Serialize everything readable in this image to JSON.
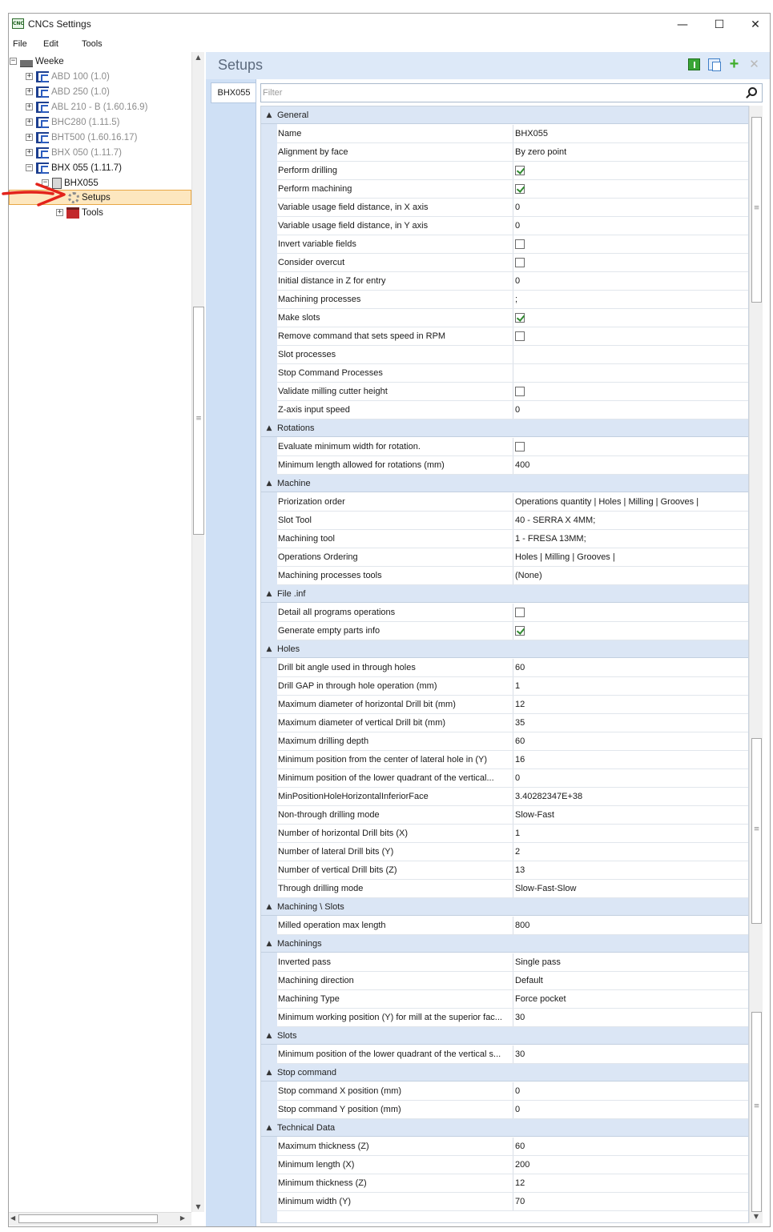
{
  "window": {
    "title": "CNCs Settings",
    "icon_label": "CNC"
  },
  "menu": [
    "File",
    "Edit",
    "Tools"
  ],
  "tree": {
    "root": "Weeke",
    "machines": [
      {
        "label": "ABD 100 (1.0)",
        "muted": true
      },
      {
        "label": "ABD 250 (1.0)",
        "muted": true
      },
      {
        "label": "ABL 210 - B (1.60.16.9)",
        "muted": true
      },
      {
        "label": "BHC280 (1.11.5)",
        "muted": true
      },
      {
        "label": "BHT500 (1.60.16.17)",
        "muted": true
      },
      {
        "label": "BHX 050 (1.11.7)",
        "muted": true
      },
      {
        "label": "BHX 055 (1.11.7)",
        "muted": false
      }
    ],
    "child": "BHX055",
    "setups": "Setups",
    "tools": "Tools"
  },
  "main": {
    "title": "Setups",
    "tab": "BHX055",
    "filter_placeholder": "Filter"
  },
  "categories": [
    {
      "name": "General",
      "rows": [
        {
          "name": "Name",
          "value": "BHX055"
        },
        {
          "name": "Alignment by face",
          "value": "By zero point"
        },
        {
          "name": "Perform drilling",
          "check": true
        },
        {
          "name": "Perform machining",
          "check": true
        },
        {
          "name": "Variable usage field distance, in X axis",
          "value": "0"
        },
        {
          "name": "Variable usage field distance, in Y axis",
          "value": "0"
        },
        {
          "name": "Invert variable fields",
          "check": false
        },
        {
          "name": "Consider overcut",
          "check": false
        },
        {
          "name": "Initial distance in Z for entry",
          "value": "0"
        },
        {
          "name": "Machining processes",
          "value": ";"
        },
        {
          "name": "Make slots",
          "check": true
        },
        {
          "name": "Remove command that sets speed in RPM",
          "check": false
        },
        {
          "name": "Slot processes",
          "value": ""
        },
        {
          "name": "Stop Command Processes",
          "value": ""
        },
        {
          "name": "Validate milling cutter height",
          "check": false
        },
        {
          "name": "Z-axis input speed",
          "value": "0"
        }
      ]
    },
    {
      "name": "Rotations",
      "rows": [
        {
          "name": "Evaluate minimum width for rotation.",
          "check": false
        },
        {
          "name": "Minimum length allowed for rotations (mm)",
          "value": "400"
        }
      ]
    },
    {
      "name": "Machine",
      "rows": [
        {
          "name": "Priorization order",
          "value": "Operations quantity | Holes | Milling | Grooves |"
        },
        {
          "name": "Slot Tool",
          "value": "40 - SERRA X 4MM;"
        },
        {
          "name": "Machining tool",
          "value": "1 - FRESA 13MM;"
        },
        {
          "name": "Operations Ordering",
          "value": "Holes | Milling | Grooves |"
        },
        {
          "name": "Machining processes tools",
          "value": "(None)"
        }
      ]
    },
    {
      "name": "File .inf",
      "rows": [
        {
          "name": "Detail all programs operations",
          "check": false
        },
        {
          "name": "Generate empty parts info",
          "check": true
        }
      ]
    },
    {
      "name": "Holes",
      "rows": [
        {
          "name": "Drill bit angle used in through holes",
          "value": "60"
        },
        {
          "name": "Drill GAP in through hole operation (mm)",
          "value": "1"
        },
        {
          "name": "Maximum diameter of horizontal Drill bit (mm)",
          "value": "12"
        },
        {
          "name": "Maximum diameter of vertical Drill bit (mm)",
          "value": "35"
        },
        {
          "name": "Maximum drilling depth",
          "value": "60"
        },
        {
          "name": "Minimum position from the center of lateral hole in (Y)",
          "value": "16"
        },
        {
          "name": "Minimum position of the lower quadrant of the vertical...",
          "value": "0"
        },
        {
          "name": "MinPositionHoleHorizontalInferiorFace",
          "value": "3.40282347E+38"
        },
        {
          "name": "Non-through drilling mode",
          "value": "Slow-Fast"
        },
        {
          "name": "Number of horizontal Drill bits (X)",
          "value": "1"
        },
        {
          "name": "Number of lateral Drill bits (Y)",
          "value": "2"
        },
        {
          "name": "Number of vertical Drill bits (Z)",
          "value": "13"
        },
        {
          "name": "Through drilling mode",
          "value": "Slow-Fast-Slow"
        }
      ]
    },
    {
      "name": "Machining \\ Slots",
      "rows": [
        {
          "name": "Milled operation max length",
          "value": "800"
        }
      ]
    },
    {
      "name": "Machinings",
      "rows": [
        {
          "name": "Inverted pass",
          "value": "Single pass"
        },
        {
          "name": "Machining direction",
          "value": "Default"
        },
        {
          "name": "Machining Type",
          "value": "Force pocket"
        },
        {
          "name": "Minimum working position (Y) for mill at the superior fac...",
          "value": "30"
        }
      ]
    },
    {
      "name": "Slots",
      "rows": [
        {
          "name": "Minimum position of the lower quadrant of the vertical s...",
          "value": "30"
        }
      ]
    },
    {
      "name": "Stop command",
      "rows": [
        {
          "name": "Stop command X position (mm)",
          "value": "0"
        },
        {
          "name": "Stop command Y position (mm)",
          "value": "0"
        }
      ]
    },
    {
      "name": "Technical Data",
      "rows": [
        {
          "name": "Maximum thickness (Z)",
          "value": "60"
        },
        {
          "name": "Minimum length (X)",
          "value": "200"
        },
        {
          "name": "Minimum thickness (Z)",
          "value": "12"
        },
        {
          "name": "Minimum width (Y)",
          "value": "70"
        }
      ]
    }
  ]
}
